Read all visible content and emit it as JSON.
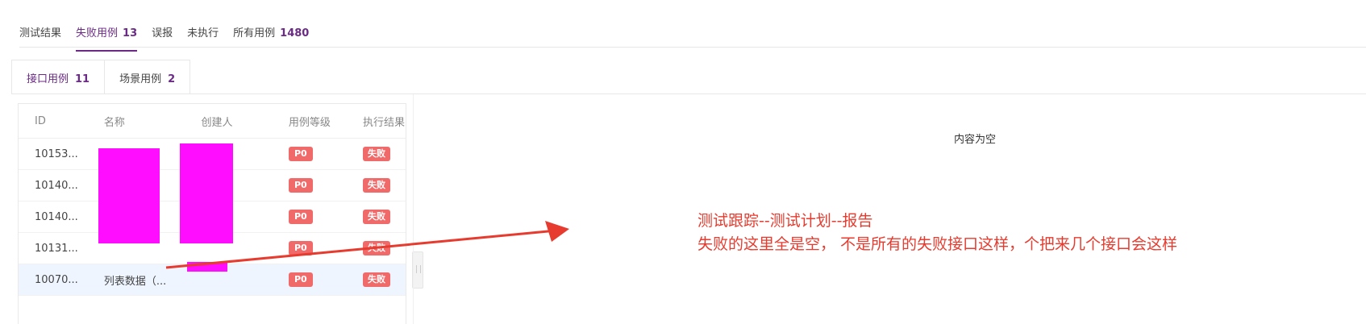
{
  "top_tabs": [
    {
      "label": "测试结果",
      "count": ""
    },
    {
      "label": "失败用例",
      "count": "13"
    },
    {
      "label": "误报",
      "count": ""
    },
    {
      "label": "未执行",
      "count": ""
    },
    {
      "label": "所有用例",
      "count": "1480"
    }
  ],
  "sub_tabs": [
    {
      "label": "接口用例",
      "count": "11"
    },
    {
      "label": "场景用例",
      "count": "2"
    }
  ],
  "table": {
    "headers": [
      "ID",
      "名称",
      "创建人",
      "用例等级",
      "执行结果"
    ],
    "rows": [
      {
        "id": "10153...",
        "name": "",
        "creator": "",
        "level": "P0",
        "result": "失败"
      },
      {
        "id": "10140...",
        "name": "",
        "creator": "",
        "level": "P0",
        "result": "失败"
      },
      {
        "id": "10140...",
        "name": "",
        "creator": "",
        "level": "P0",
        "result": "失败"
      },
      {
        "id": "10131...",
        "name": "",
        "creator": "",
        "level": "P0",
        "result": "失败"
      },
      {
        "id": "10070...",
        "name": "列表数据（...",
        "creator": "",
        "level": "P0",
        "result": "失败"
      }
    ]
  },
  "right_pane": {
    "empty_text": "内容为空"
  },
  "annotation": {
    "line1": "测试跟踪--测试计划--报告",
    "line2": "失败的这里全是空， 不是所有的失败接口这样，个把来几个接口会这样",
    "color": "#e63b2e"
  },
  "colors": {
    "accent": "#6b2a86",
    "badge": "#f06a6a",
    "redact": "#ff00ff"
  }
}
